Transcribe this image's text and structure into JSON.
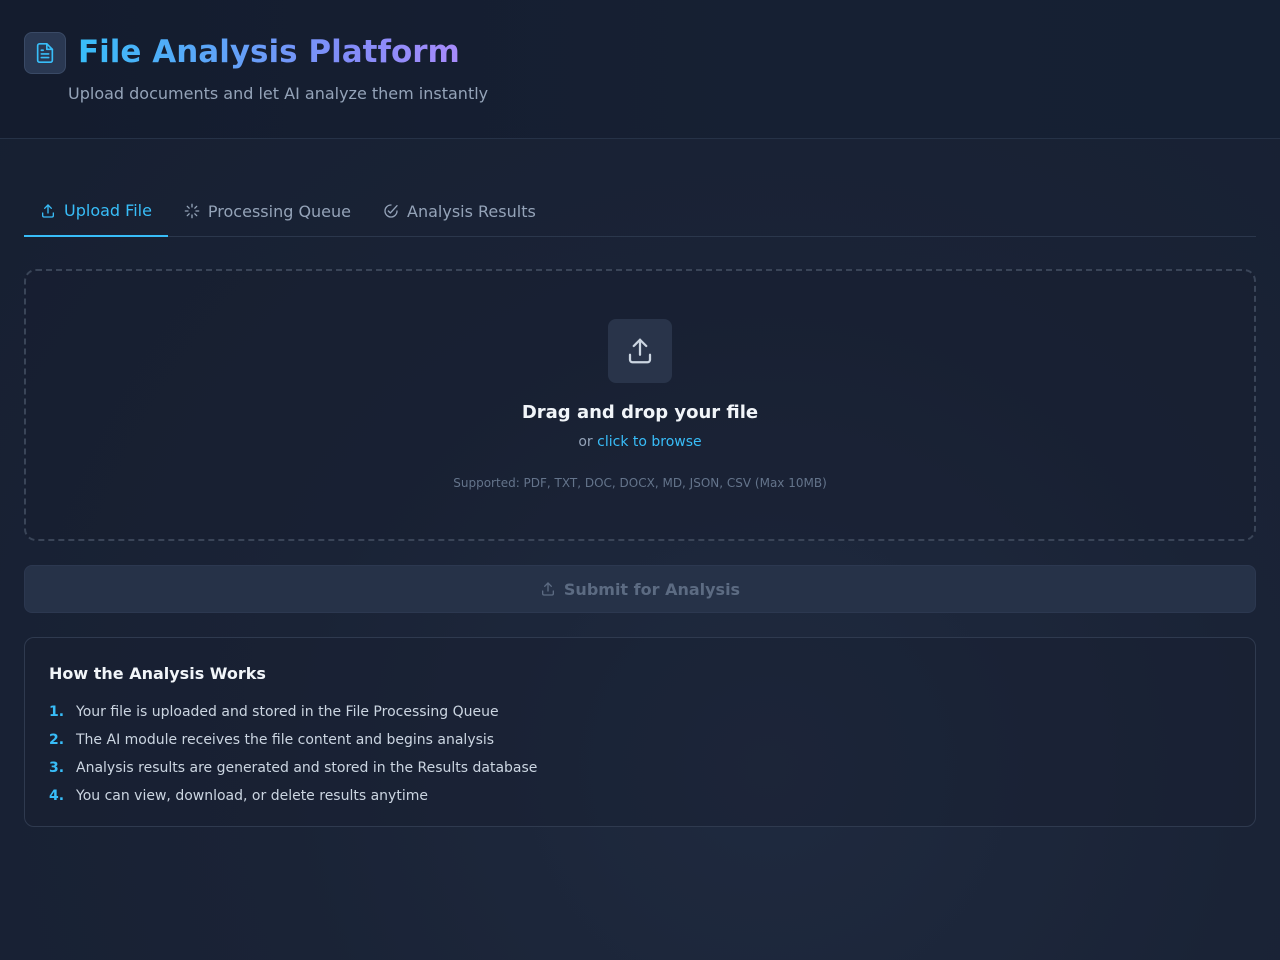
{
  "header": {
    "title": "File Analysis Platform",
    "subtitle": "Upload documents and let AI analyze them instantly",
    "logo_icon": "document-icon"
  },
  "tabs": [
    {
      "label": "Upload File",
      "icon": "upload-icon",
      "active": true
    },
    {
      "label": "Processing Queue",
      "icon": "spinner-icon",
      "active": false
    },
    {
      "label": "Analysis Results",
      "icon": "check-circle-icon",
      "active": false
    }
  ],
  "dropzone": {
    "title": "Drag and drop your file",
    "or_text": "or",
    "browse_link": "click to browse",
    "supported": "Supported: PDF, TXT, DOC, DOCX, MD, JSON, CSV (Max 10MB)"
  },
  "submit": {
    "label": "Submit for Analysis",
    "disabled": true
  },
  "info": {
    "title": "How the Analysis Works",
    "steps": [
      {
        "num": "1.",
        "text": "Your file is uploaded and stored in the File Processing Queue"
      },
      {
        "num": "2.",
        "text": "The AI module receives the file content and begins analysis"
      },
      {
        "num": "3.",
        "text": "Analysis results are generated and stored in the Results database"
      },
      {
        "num": "4.",
        "text": "You can view, download, or delete results anytime"
      }
    ]
  },
  "colors": {
    "accent": "#38bdf8",
    "accent_secondary": "#818cf8",
    "background": "#1b2538",
    "muted_text": "#94a3b8"
  }
}
